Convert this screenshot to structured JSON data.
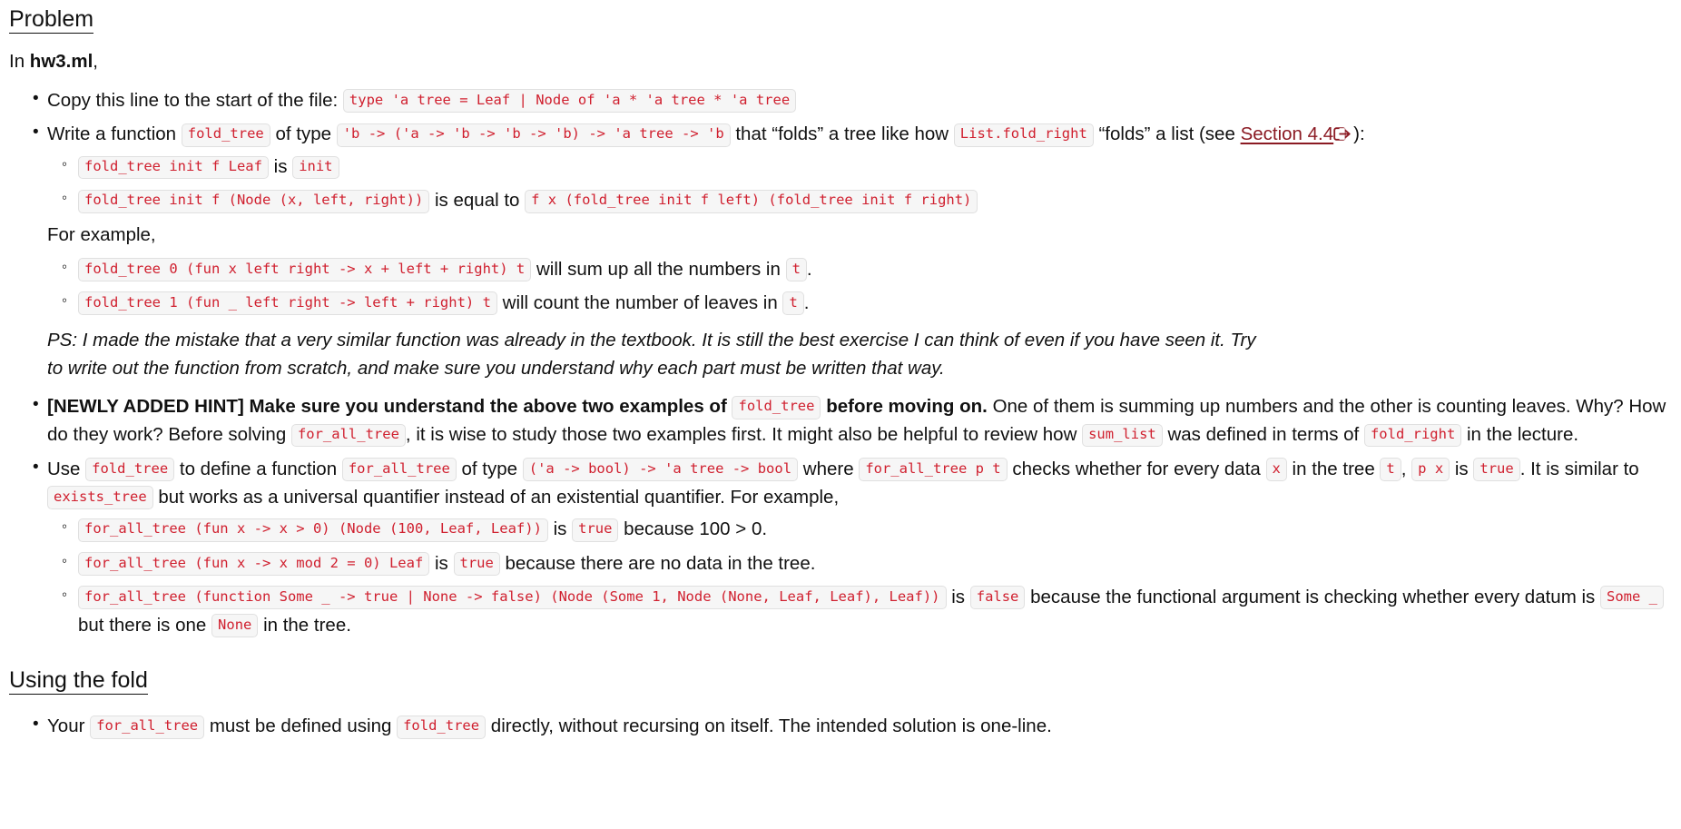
{
  "document": {
    "headings": {
      "problem": "Problem",
      "using_the_fold": "Using the fold"
    },
    "intro": {
      "prefix": "In ",
      "filename": "hw3.ml",
      "suffix": ","
    },
    "bullets": {
      "copy_line": {
        "text_before": "Copy this line to the start of the file:",
        "code": "type 'a tree = Leaf | Node of 'a * 'a tree * 'a tree"
      },
      "write_fold_tree": {
        "t1": "Write a function",
        "code_fn": "fold_tree",
        "t2": "of type",
        "code_type": "'b -> ('a -> 'b -> 'b -> 'b) -> 'a tree -> 'b",
        "t3": "that “folds” a tree like how",
        "code_list_fold": "List.fold_right",
        "t4": "“folds” a list (see",
        "link_label": "Section 4.4",
        "link_icon": "external-link-icon",
        "t5": "):"
      },
      "fold_rules": [
        {
          "code": "fold_tree init f Leaf",
          "mid": "is",
          "code2": "init",
          "tail": ""
        },
        {
          "code": "fold_tree init f (Node (x, left, right))",
          "mid": "is equal to",
          "code2": "f x (fold_tree init f left) (fold_tree init f right)",
          "tail": ""
        }
      ],
      "for_example_label": "For example,",
      "fold_examples": [
        {
          "code": "fold_tree 0 (fun x left right -> x + left + right) t",
          "mid": "will sum up all the numbers in",
          "code2": "t",
          "tail": "."
        },
        {
          "code": "fold_tree 1 (fun _ left right -> left + right) t",
          "mid": "will count the number of leaves in",
          "code2": "t",
          "tail": "."
        }
      ],
      "ps_note": "PS: I made the mistake that a very similar function was already in the textbook. It is still the best exercise I can think of even if you have seen it. Try to write out the function from scratch, and make sure you understand why each part must be written that way.",
      "newly_added_hint": {
        "bold_lead": "[NEWLY ADDED HINT] Make sure you understand the above two examples of",
        "code_fold_tree": "fold_tree",
        "bold_tail": "before moving on.",
        "t1": "One of them is summing up numbers and the other is counting leaves. Why? How do they work? Before solving",
        "code_for_all_tree": "for_all_tree",
        "t2": ", it is wise to study those two examples first. It might also be helpful to review how",
        "code_sum_list": "sum_list",
        "t3": "was defined in terms of",
        "code_fold_right": "fold_right",
        "t4": "in the lecture."
      },
      "use_fold_tree": {
        "t1": "Use",
        "code_fold_tree": "fold_tree",
        "t2": "to define a function",
        "code_for_all_tree": "for_all_tree",
        "t3": "of type",
        "code_type": "('a -> bool) -> 'a tree -> bool",
        "t4": "where",
        "code_call": "for_all_tree p t",
        "t5": "checks whether for every data",
        "code_x": "x",
        "t6": "in the tree",
        "code_t": "t",
        "t7": ",",
        "code_px": "p x",
        "t8": "is",
        "code_true": "true",
        "t9": ". It is similar to",
        "code_exists_tree": "exists_tree",
        "t10": "but works as a universal quantifier instead of an existential quantifier. For example,"
      },
      "for_all_examples": [
        {
          "code": "for_all_tree (fun x -> x > 0) (Node (100, Leaf, Leaf))",
          "mid": "is",
          "code2": "true",
          "tail": "because 100 > 0."
        },
        {
          "code": "for_all_tree (fun x -> x mod 2 = 0) Leaf",
          "mid": "is",
          "code2": "true",
          "tail": "because there are no data in the tree."
        },
        {
          "code": "for_all_tree (function Some _ -> true | None -> false) (Node (Some 1, Node (None, Leaf, Leaf), Leaf))",
          "mid": "is",
          "code2": "false",
          "tail_a": "because the functional argument is checking whether every datum is",
          "code3": "Some _",
          "tail_b": "but there is one",
          "code4": "None",
          "tail_c": "in the tree."
        }
      ],
      "using_fold_item": {
        "t1": "Your",
        "code_for_all_tree": "for_all_tree",
        "t2": "must be defined using",
        "code_fold_tree": "fold_tree",
        "t3": "directly, without recursing on itself. The intended solution is one-line."
      }
    },
    "colors": {
      "code_text": "#d0202f",
      "code_bg": "#f6f6f6",
      "code_border": "#e0e0e0",
      "link": "#8b1a23",
      "body_text": "#111111",
      "page_bg": "#ffffff"
    }
  }
}
